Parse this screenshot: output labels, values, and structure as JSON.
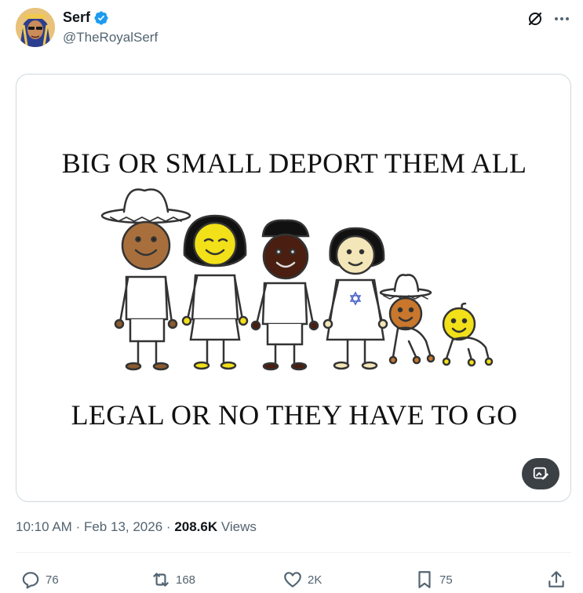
{
  "author": {
    "name": "Serf",
    "handle": "@TheRoyalSerf",
    "verified": true
  },
  "media": {
    "caption_top": "BIG OR SMALL DEPORT THEM ALL",
    "caption_bottom": "LEGAL OR NO THEY HAVE TO GO"
  },
  "meta": {
    "time": "10:10 AM",
    "separator": "·",
    "date": "Feb 13, 2026",
    "views_count": "208.6K",
    "views_label": "Views"
  },
  "actions": {
    "replies": "76",
    "reposts": "168",
    "likes": "2K",
    "bookmarks": "75"
  },
  "colors": {
    "accent": "#1d9bf0",
    "text_secondary": "#536471",
    "text_primary": "#0f1419"
  }
}
